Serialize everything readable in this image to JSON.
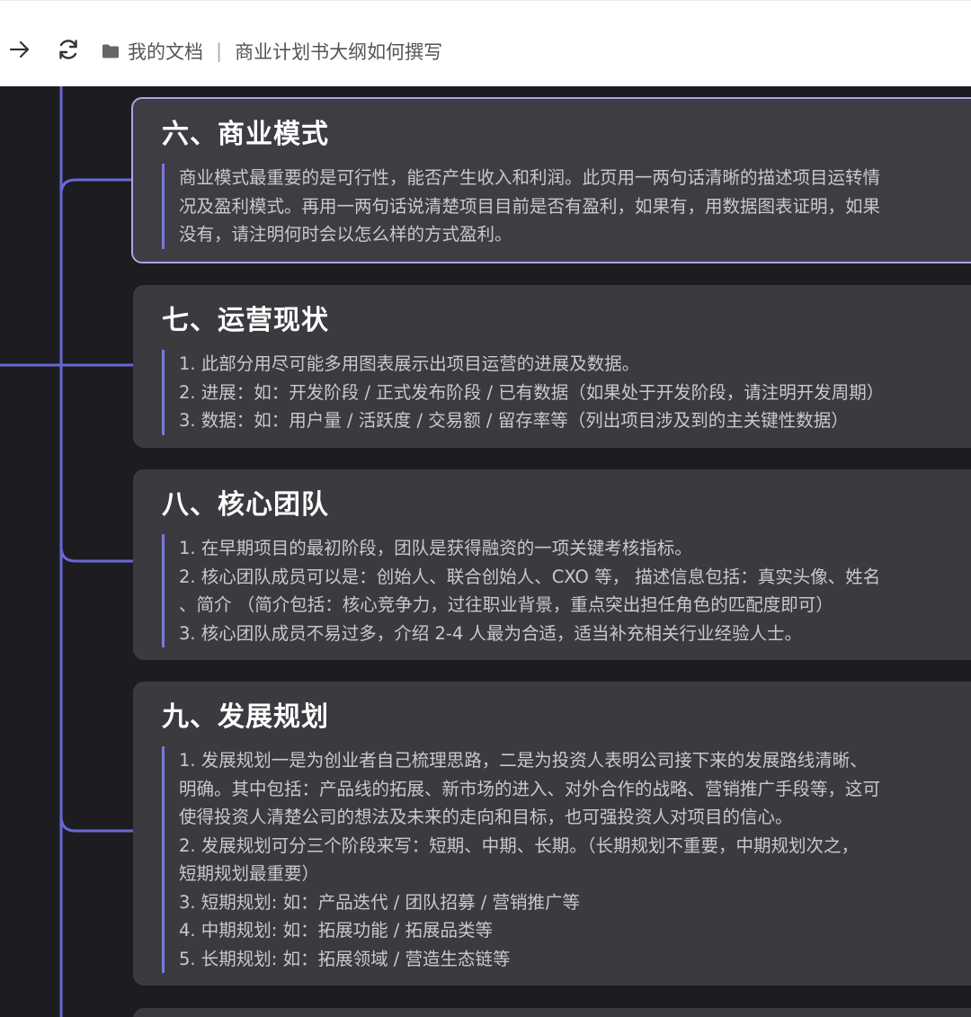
{
  "toolbar": {
    "forward_icon": "arrow-right-icon",
    "refresh_icon": "refresh-icon",
    "folder_icon": "folder-icon"
  },
  "breadcrumb": {
    "root": "我的文档",
    "separator": "|",
    "current": "商业计划书大纲如何撰写"
  },
  "colors": {
    "canvas_bg": "#1d1d21",
    "card_bg": "#3a3a3f",
    "connector": "#6a66d6",
    "active_border": "#a8a6e4",
    "accent_bar": "#7b78d9"
  },
  "cards": [
    {
      "title": "六、商业模式",
      "lines": [
        "商业模式最重要的是可行性，能否产生收入和利润。此页用一两句话清晰的描述项目运转情",
        "况及盈利模式。再用一两句话说清楚项目目前是否有盈利，如果有，用数据图表证明，如果",
        "没有，请注明何时会以怎么样的方式盈利。"
      ]
    },
    {
      "title": "七、运营现状",
      "lines": [
        "1. 此部分用尽可能多用图表展示出项目运营的进展及数据。",
        "2. 进展：如：开发阶段 / 正式发布阶段 / 已有数据（如果处于开发阶段，请注明开发周期）",
        "3. 数据：如：用户量 / 活跃度 / 交易额 / 留存率等（列出项目涉及到的主关键性数据）"
      ]
    },
    {
      "title": "八、核心团队",
      "lines": [
        "1. 在早期项目的最初阶段，团队是获得融资的一项关键考核指标。",
        "2. 核心团队成员可以是：创始人、联合创始人、CXO 等， 描述信息包括：真实头像、姓名",
        "、简介 （简介包括：核心竞争力，过往职业背景，重点突出担任角色的匹配度即可）",
        "3. 核心团队成员不易过多，介绍 2-4 人最为合适，适当补充相关行业经验人士。"
      ]
    },
    {
      "title": "九、发展规划",
      "lines": [
        "1. 发展规划一是为创业者自己梳理思路，二是为投资人表明公司接下来的发展路线清晰、",
        "明确。其中包括：产品线的拓展、新市场的进入、对外合作的战略、营销推广手段等，这可",
        "使得投资人清楚公司的想法及未来的走向和目标，也可强投资人对项目的信心。",
        "2. 发展规划可分三个阶段来写：短期、中期、长期。（长期规划不重要，中期规划次之，",
        "短期规划最重要）",
        "3. 短期规划: 如：产品迭代 / 团队招募 / 营销推广等",
        "4. 中期规划: 如：拓展功能 / 拓展品类等",
        "5. 长期规划: 如：拓展领域 / 营造生态链等"
      ]
    }
  ]
}
